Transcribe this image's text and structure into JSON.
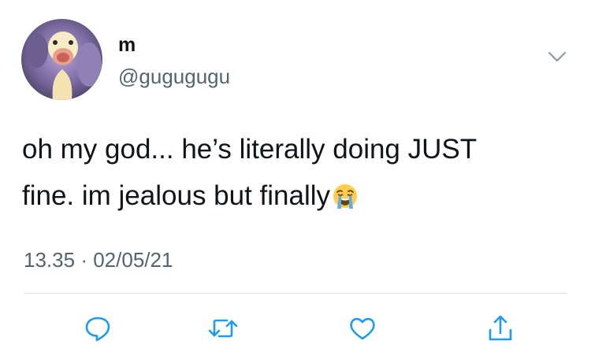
{
  "author": {
    "display_name": "m",
    "handle": "@gugugugu",
    "avatar_icon": "avatar-duck-photo"
  },
  "tweet": {
    "text_line1": "oh my god... he’s literally doing JUST",
    "text_line2": "fine. im jealous but finally",
    "emoji": "loudly-crying-face",
    "time": "13.35",
    "separator": "·",
    "date": "02/05/21"
  },
  "actions": [
    {
      "name": "reply",
      "icon": "reply-icon"
    },
    {
      "name": "retweet",
      "icon": "retweet-icon"
    },
    {
      "name": "like",
      "icon": "heart-icon"
    },
    {
      "name": "share",
      "icon": "share-icon"
    }
  ],
  "colors": {
    "text": "#0f1419",
    "secondary": "#536471",
    "divider": "#dfe3e6",
    "icon": "#1d9bf0"
  }
}
